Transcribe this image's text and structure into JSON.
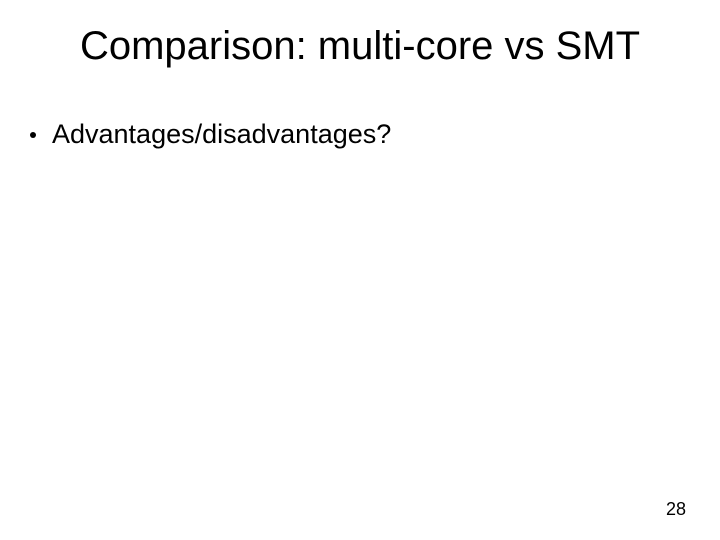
{
  "slide": {
    "title": "Comparison: multi-core vs SMT",
    "bullets": [
      {
        "text": "Advantages/disadvantages?"
      }
    ],
    "page_number": "28"
  }
}
